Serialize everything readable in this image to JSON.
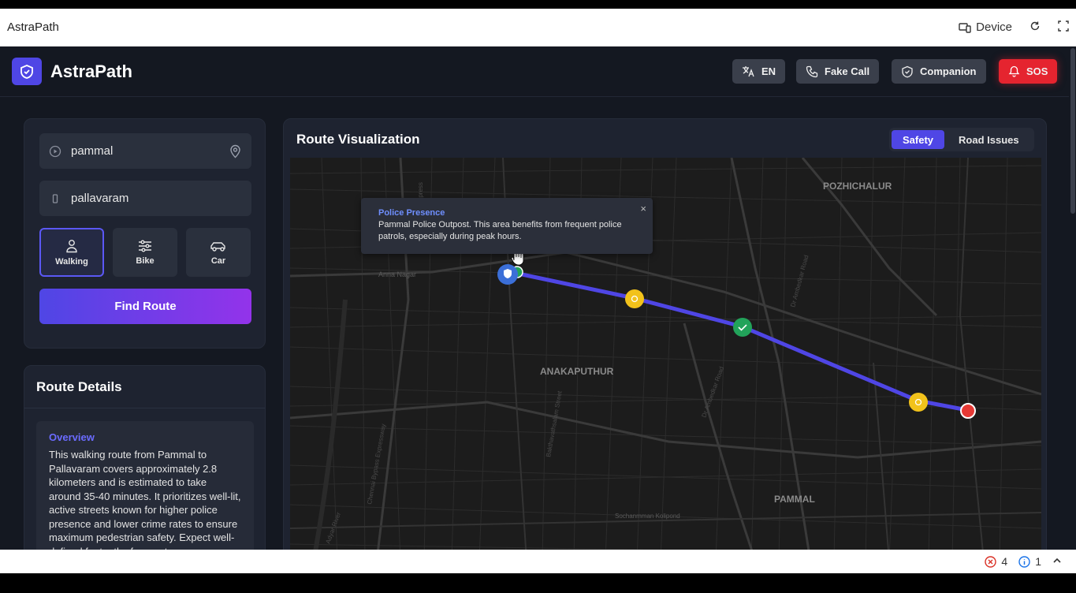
{
  "preview": {
    "title": "AstraPath",
    "device_label": "Device",
    "refresh_icon": "refresh-icon",
    "fullscreen_icon": "fullscreen-icon"
  },
  "header": {
    "brand": "AstraPath",
    "lang_label": "EN",
    "fake_call_label": "Fake Call",
    "companion_label": "Companion",
    "sos_label": "SOS"
  },
  "search": {
    "from_value": "pammal",
    "to_value": "pallavaram",
    "modes": [
      {
        "label": "Walking",
        "active": true
      },
      {
        "label": "Bike",
        "active": false
      },
      {
        "label": "Car",
        "active": false
      }
    ],
    "find_label": "Find Route"
  },
  "details": {
    "title": "Route Details",
    "overview_heading": "Overview",
    "overview_text": "This walking route from Pammal to Pallavaram covers approximately 2.8 kilometers and is estimated to take around 35-40 minutes. It prioritizes well-lit, active streets known for higher police presence and lower crime rates to ensure maximum pedestrian safety. Expect well-defined footpaths for most"
  },
  "map": {
    "title": "Route Visualization",
    "tab_safety": "Safety",
    "tab_road_issues": "Road Issues",
    "popup_title": "Police Presence",
    "popup_body": "Pammal Police Outpost. This area benefits from frequent police patrols, especially during peak hours.",
    "popup_close": "×",
    "areas": {
      "pozhichalur": "POZHICHALUR",
      "anakaputhur": "ANAKAPUTHUR",
      "pammal": "PAMMAL",
      "anna_nagar": "Anna Nagar",
      "sochanmman": "Sochanmman Kolipond",
      "express": "Express",
      "road1": "Dr Ambedkar Road",
      "road2": "Dr Ambedkar Road",
      "road3": "Bakthavathsalam Street",
      "road4": "Chennai Bypass Expressway",
      "road5": "Adyar River"
    },
    "route_color": "#4f46e5"
  },
  "statusbar": {
    "errors": "4",
    "info": "1"
  },
  "colors": {
    "accent": "#4f46e5",
    "sos": "#e5242f",
    "safe_marker": "#22a35a",
    "warn_marker": "#f2c21b",
    "end_marker": "#e53935"
  }
}
